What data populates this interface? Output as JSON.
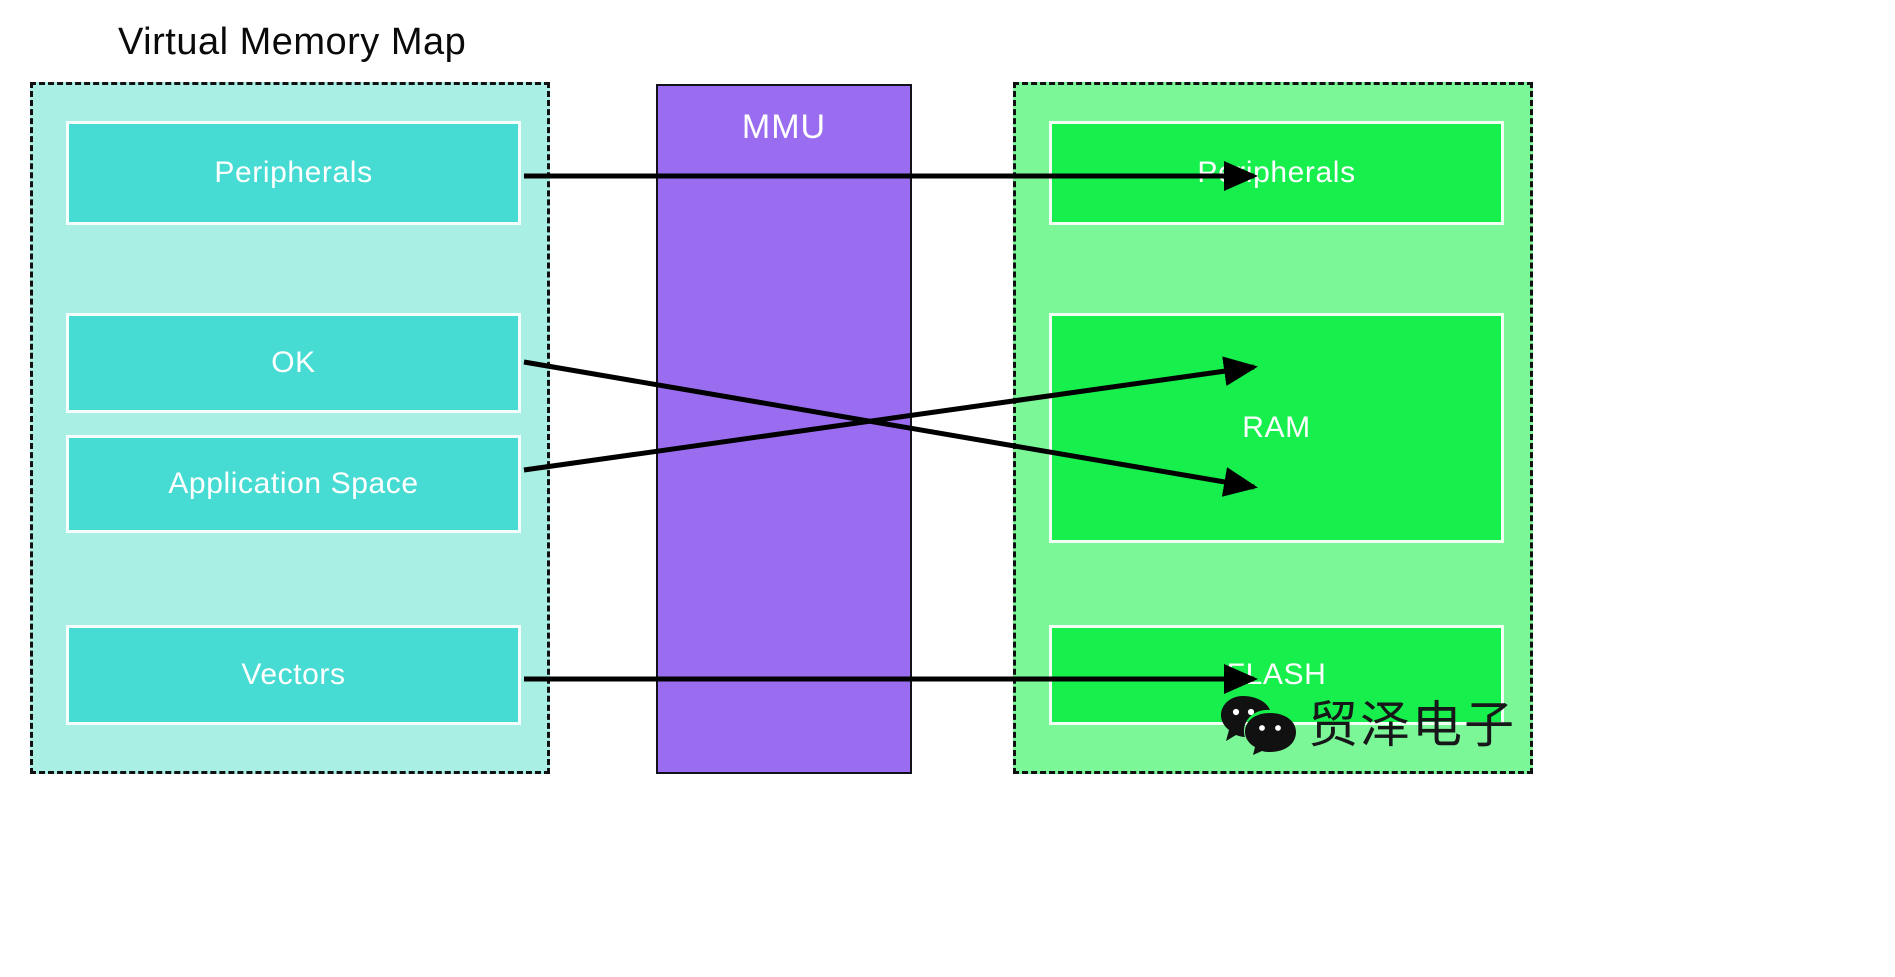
{
  "title": "Virtual Memory Map",
  "mmu": {
    "label": "MMU",
    "color": "#9a6df0"
  },
  "virtual_region": {
    "name": "Virtual Memory Map",
    "fill": "#a9efe4",
    "block_fill": "#47dcd3",
    "border_style": "dashed",
    "blocks": [
      {
        "label": "Peripherals"
      },
      {
        "label": "OK"
      },
      {
        "label": "Application Space"
      },
      {
        "label": "Vectors"
      }
    ]
  },
  "physical_region": {
    "fill": "#7bf798",
    "block_fill": "#16ef4c",
    "border_style": "dashed",
    "blocks": [
      {
        "label": "Peripherals"
      },
      {
        "label": "RAM"
      },
      {
        "label": "FLASH"
      }
    ]
  },
  "mappings": [
    {
      "from": "Peripherals",
      "to": "Peripherals"
    },
    {
      "from": "OK",
      "to": "RAM"
    },
    {
      "from": "Application Space",
      "to": "RAM"
    },
    {
      "from": "Vectors",
      "to": "FLASH"
    }
  ],
  "watermark": {
    "text": "贸泽电子",
    "icon": "wechat-icon"
  },
  "colors": {
    "arrow": "#000000",
    "dashed_border": "#111111",
    "label_text": "#ffffff",
    "title_text": "#0a0a0a"
  }
}
